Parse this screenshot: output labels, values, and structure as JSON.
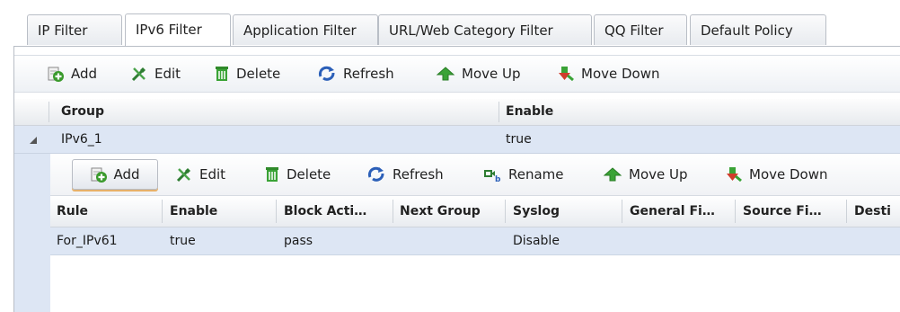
{
  "tabs": [
    {
      "label": "IP Filter",
      "active": false
    },
    {
      "label": "IPv6 Filter",
      "active": true
    },
    {
      "label": "Application Filter",
      "active": false
    },
    {
      "label": "URL/Web Category Filter",
      "active": false
    },
    {
      "label": "QQ Filter",
      "active": false
    },
    {
      "label": "Default Policy",
      "active": false
    }
  ],
  "toolbar": {
    "add": "Add",
    "edit": "Edit",
    "delete": "Delete",
    "refresh": "Refresh",
    "move_up": "Move Up",
    "move_down": "Move Down"
  },
  "group_table": {
    "columns": [
      "Group",
      "Enable"
    ],
    "rows": [
      {
        "group": "IPv6_1",
        "enable": "true"
      }
    ]
  },
  "sub_toolbar": {
    "add": "Add",
    "edit": "Edit",
    "delete": "Delete",
    "refresh": "Refresh",
    "rename": "Rename",
    "move_up": "Move Up",
    "move_down": "Move Down"
  },
  "rule_table": {
    "columns": [
      "Rule",
      "Enable",
      "Block Acti…",
      "Next Group",
      "Syslog",
      "General Fi…",
      "Source Fi…",
      "Desti"
    ],
    "rows": [
      {
        "rule": "For_IPv61",
        "enable": "true",
        "block_action": "pass",
        "next_group": "",
        "syslog": "Disable",
        "general": "",
        "source": "",
        "dest": ""
      }
    ]
  },
  "icons": {
    "add": "add-icon",
    "edit": "edit-icon",
    "delete": "delete-icon",
    "refresh": "refresh-icon",
    "rename": "rename-icon",
    "move_up": "move-up-icon",
    "move_down": "move-down-icon",
    "expand": "collapse-triangle-icon"
  },
  "colors": {
    "selected_row": "#dde6f4",
    "add_green": "#3a9a2c",
    "delete_green": "#2f8a2a",
    "refresh_blue": "#2b5fb8",
    "edit_green": "#2e7d32",
    "move_down_red": "#d13c2c"
  }
}
